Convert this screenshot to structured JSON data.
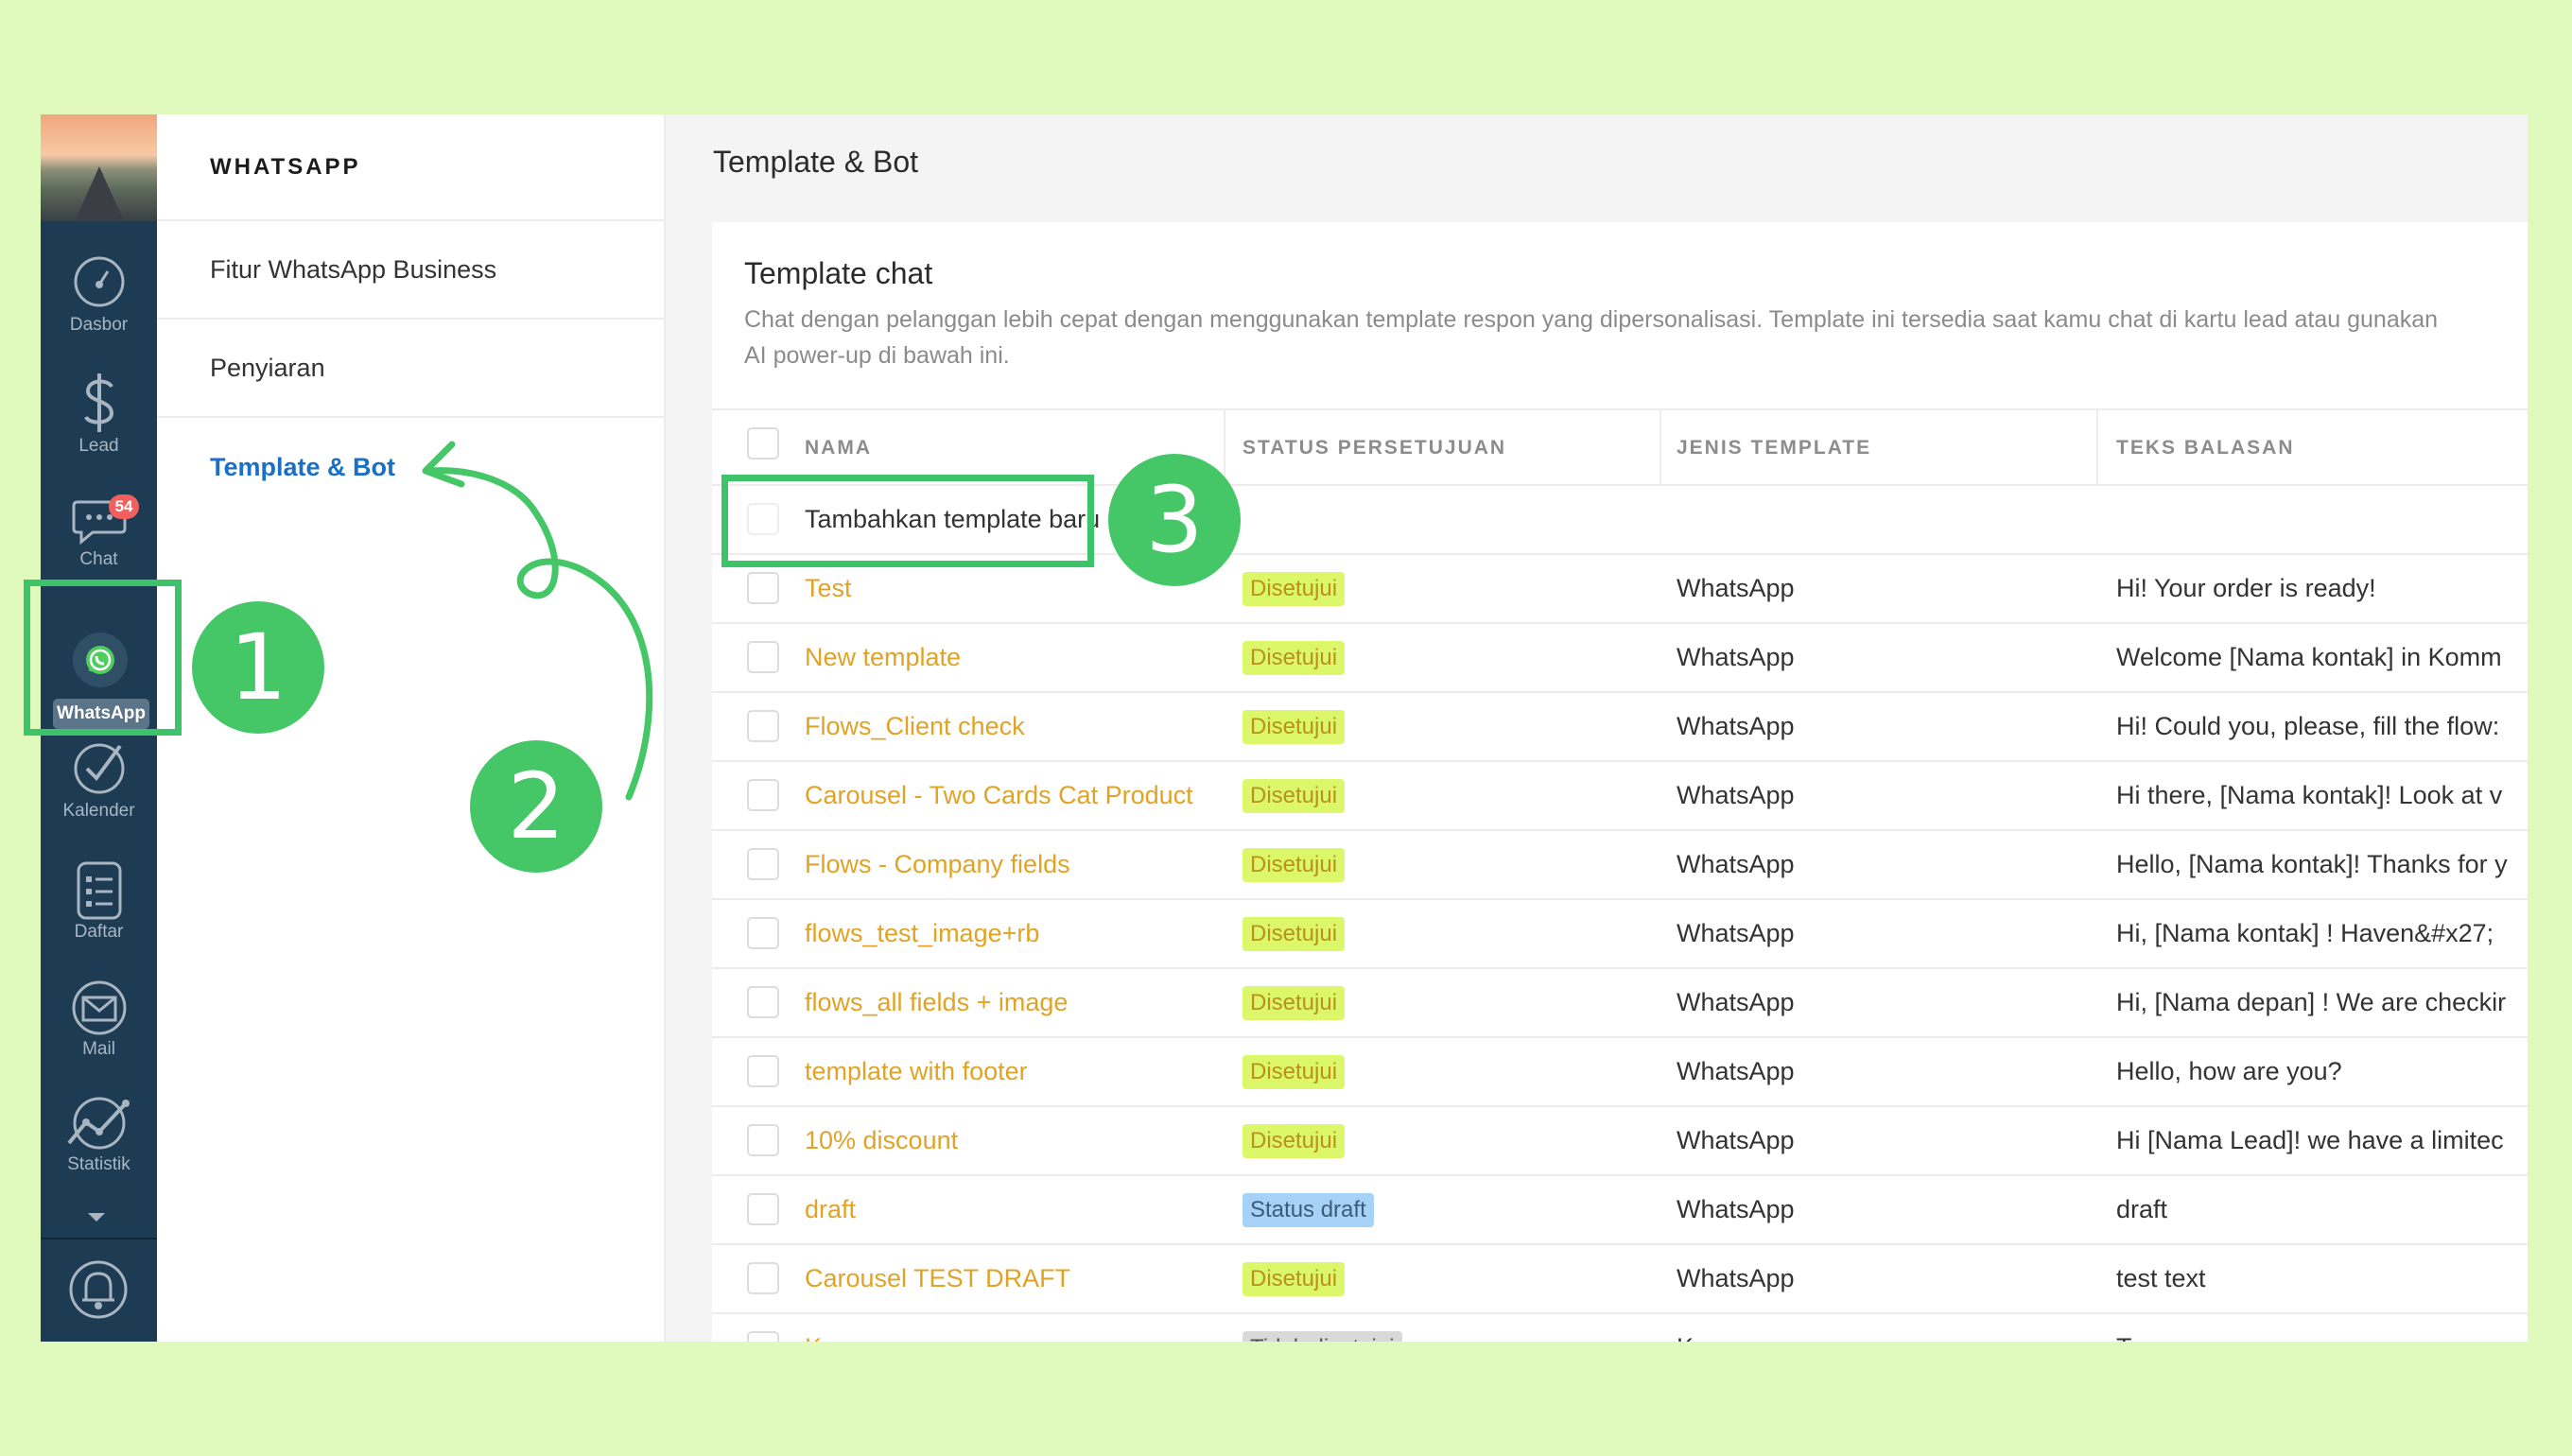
{
  "sidebar": {
    "items": [
      {
        "label": "Dasbor",
        "icon": "dashboard-gauge-icon"
      },
      {
        "label": "Lead",
        "icon": "dollar-icon"
      },
      {
        "label": "Chat",
        "icon": "chat-bubble-icon",
        "badge": "54"
      },
      {
        "label": "WhatsApp",
        "icon": "whatsapp-icon",
        "active": true
      },
      {
        "label": "Kalender",
        "icon": "checkmark-circle-icon"
      },
      {
        "label": "Daftar",
        "icon": "list-document-icon"
      },
      {
        "label": "Mail",
        "icon": "mail-icon"
      },
      {
        "label": "Statistik",
        "icon": "line-graph-icon"
      }
    ]
  },
  "submenu": {
    "title": "WHATSAPP",
    "items": [
      {
        "label": "Fitur WhatsApp Business"
      },
      {
        "label": "Penyiaran"
      },
      {
        "label": "Template & Bot",
        "active": true
      }
    ]
  },
  "main": {
    "page_title": "Template & Bot",
    "card": {
      "title": "Template chat",
      "description": "Chat dengan pelanggan lebih cepat dengan menggunakan template respon yang dipersonalisasi. Template ini tersedia saat kamu chat di kartu lead atau gunakan AI power-up di bawah ini."
    },
    "table": {
      "headers": [
        "NAMA",
        "STATUS PERSETUJUAN",
        "JENIS TEMPLATE",
        "TEKS BALASAN"
      ],
      "add_label": "Tambahkan template baru",
      "rows": [
        {
          "name": "Test",
          "status": "Disetujui",
          "status_kind": "ok",
          "type": "WhatsApp",
          "text": "Hi! Your order is ready!"
        },
        {
          "name": "New template",
          "status": "Disetujui",
          "status_kind": "ok",
          "type": "WhatsApp",
          "text": "Welcome [Nama kontak] in Komm"
        },
        {
          "name": "Flows_Client check",
          "status": "Disetujui",
          "status_kind": "ok",
          "type": "WhatsApp",
          "text": "Hi! Could you, please, fill the flow:"
        },
        {
          "name": "Carousel - Two Cards Cat Product",
          "status": "Disetujui",
          "status_kind": "ok",
          "type": "WhatsApp",
          "text": "Hi there, [Nama kontak]! Look at v"
        },
        {
          "name": "Flows - Company fields",
          "status": "Disetujui",
          "status_kind": "ok",
          "type": "WhatsApp",
          "text": "Hello, [Nama kontak]! Thanks for y"
        },
        {
          "name": "flows_test_image+rb",
          "status": "Disetujui",
          "status_kind": "ok",
          "type": "WhatsApp",
          "text": "Hi, [Nama kontak] ! Haven&#x27;"
        },
        {
          "name": "flows_all fields + image",
          "status": "Disetujui",
          "status_kind": "ok",
          "type": "WhatsApp",
          "text": "Hi, [Nama depan] ! We are checkir"
        },
        {
          "name": "template with footer",
          "status": "Disetujui",
          "status_kind": "ok",
          "type": "WhatsApp",
          "text": "Hello, how are you?"
        },
        {
          "name": "10% discount",
          "status": "Disetujui",
          "status_kind": "ok",
          "type": "WhatsApp",
          "text": "Hi [Nama Lead]! we have a limitec"
        },
        {
          "name": "draft",
          "status": "Status draft",
          "status_kind": "draft",
          "type": "WhatsApp",
          "text": "draft"
        },
        {
          "name": "Carousel TEST DRAFT",
          "status": "Disetujui",
          "status_kind": "ok",
          "type": "WhatsApp",
          "text": "test text"
        },
        {
          "name": "K",
          "status": "Tidak disetujui",
          "status_kind": "grey",
          "type": "K",
          "text": "T"
        }
      ]
    }
  },
  "tutorial": {
    "steps": [
      "1",
      "2",
      "3"
    ],
    "accent_color": "#45c768"
  }
}
